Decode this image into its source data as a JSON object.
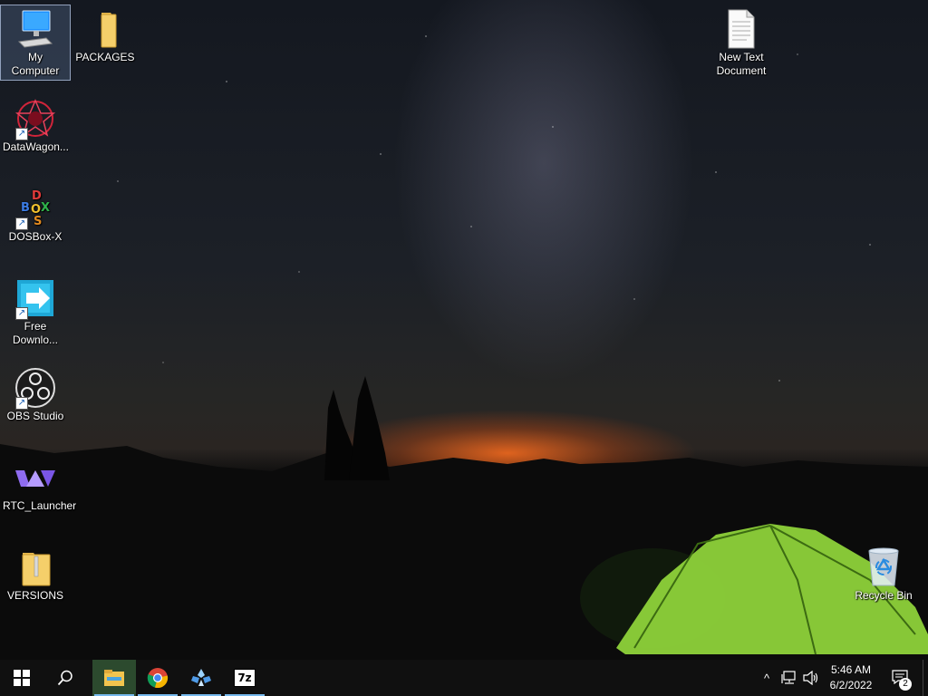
{
  "desktop": {
    "icons": [
      {
        "label": "My Computer"
      },
      {
        "label": "PACKAGES"
      },
      {
        "label": "DataWagon..."
      },
      {
        "label": "DOSBox-X"
      },
      {
        "label": "Free\nDownlo..."
      },
      {
        "label": "OBS Studio"
      },
      {
        "label": "RTC_Launcher"
      },
      {
        "label": "VERSIONS"
      },
      {
        "label": "New Text\nDocument"
      },
      {
        "label": "Recycle Bin"
      }
    ],
    "dosbox_letters": [
      "D",
      "B",
      "O",
      "X",
      "S"
    ],
    "seven_zip_label": "7z"
  },
  "taskbar": {
    "pinned": [
      {
        "name": "file-explorer"
      },
      {
        "name": "google-chrome"
      },
      {
        "name": "pcsx2"
      },
      {
        "name": "7-zip"
      }
    ],
    "clock": {
      "time": "5:46 AM",
      "date": "6/2/2022"
    },
    "notification_count": "2"
  },
  "colors": {
    "taskbar": "#101010",
    "accent": "#76b9ed",
    "tent": "#8ed23a"
  }
}
